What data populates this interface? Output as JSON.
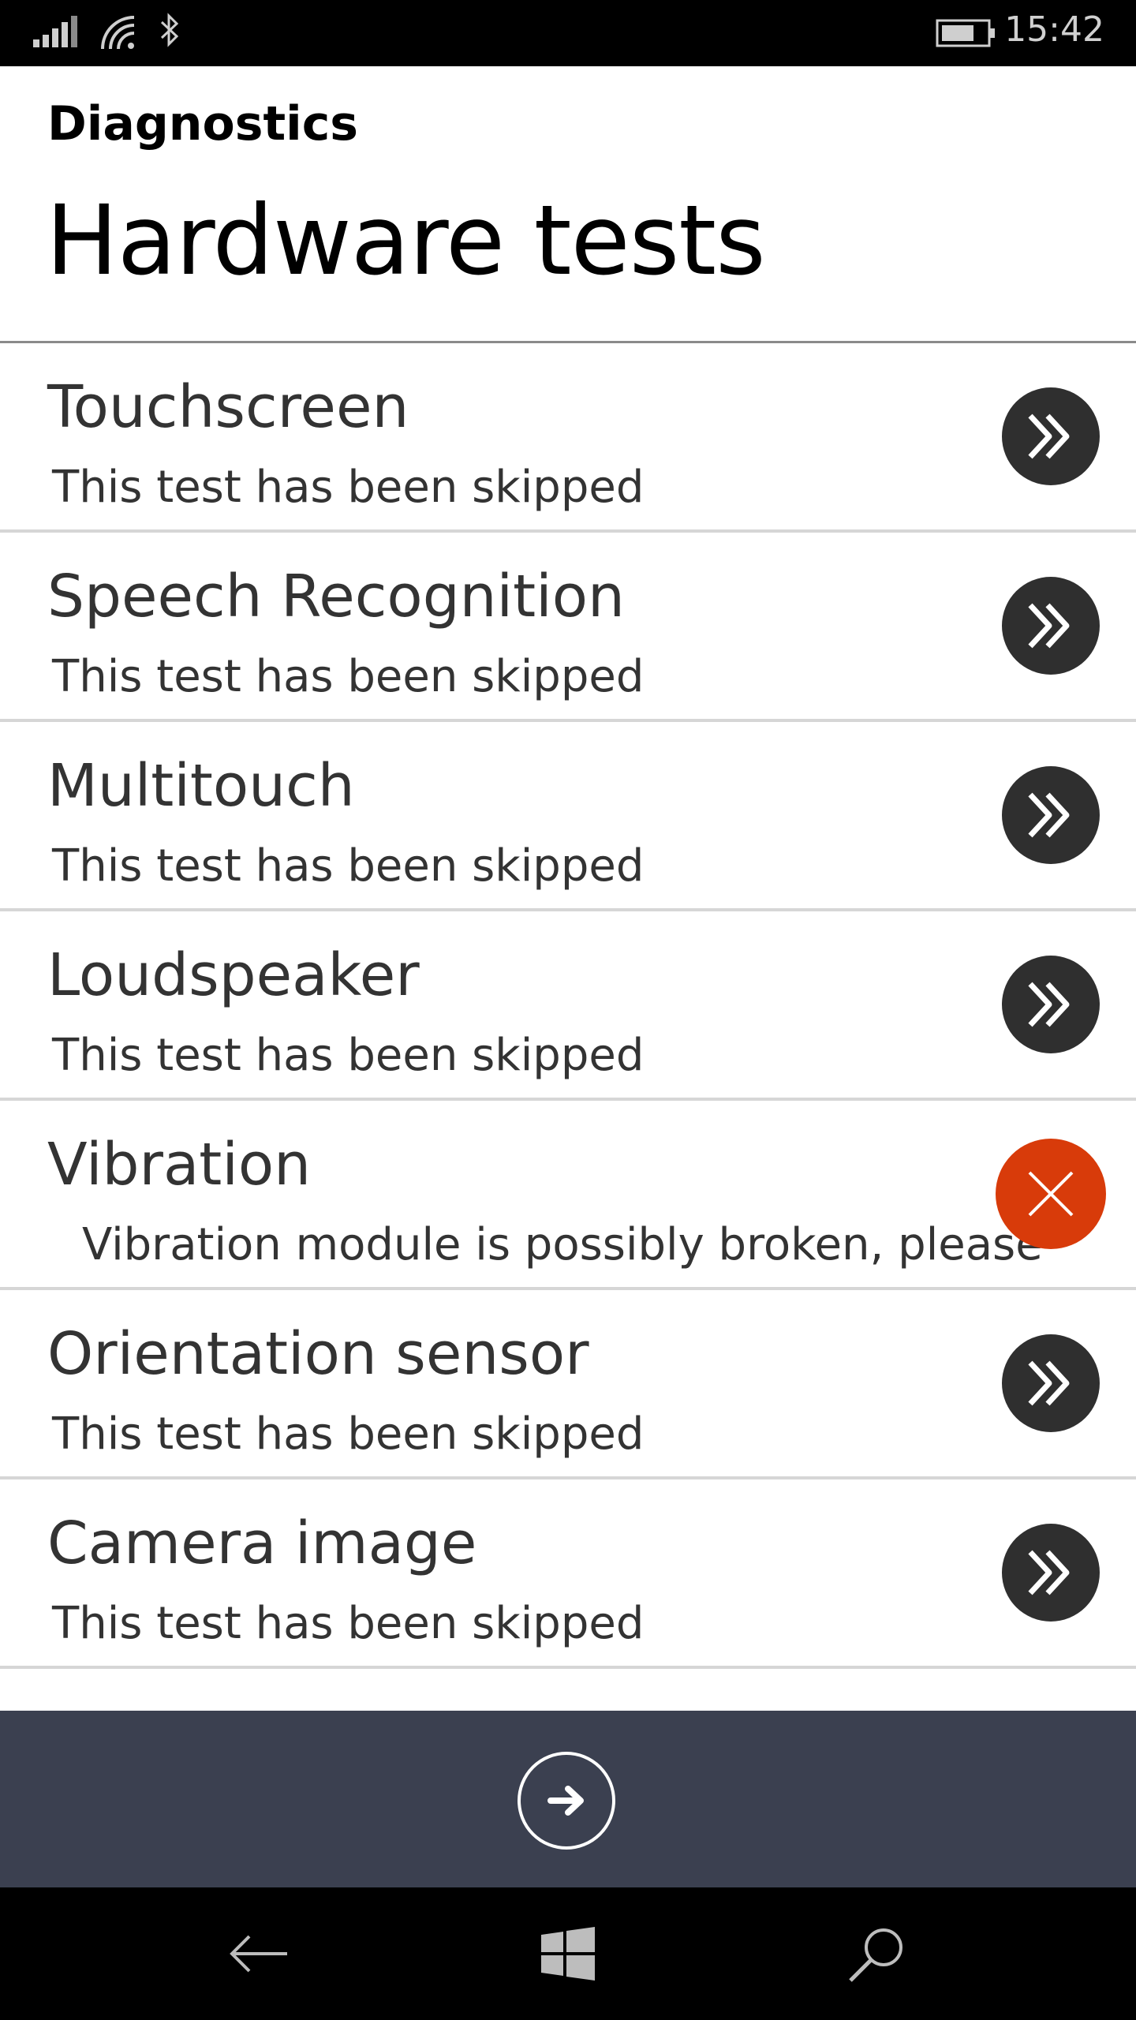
{
  "status_bar": {
    "time": "15:42",
    "icons": [
      "signal-icon",
      "wifi-icon",
      "bluetooth-icon",
      "battery-icon"
    ]
  },
  "header": {
    "app_title": "Diagnostics",
    "page_title": "Hardware tests"
  },
  "tests": [
    {
      "name": "Touchscreen",
      "status": "This test has been skipped",
      "result": "skipped",
      "icon": "skip-forward-icon"
    },
    {
      "name": "Speech Recognition",
      "status": "This test has been skipped",
      "result": "skipped",
      "icon": "skip-forward-icon"
    },
    {
      "name": "Multitouch",
      "status": "This test has been skipped",
      "result": "skipped",
      "icon": "skip-forward-icon"
    },
    {
      "name": "Loudspeaker",
      "status": "This test has been skipped",
      "result": "skipped",
      "icon": "skip-forward-icon"
    },
    {
      "name": "Vibration",
      "status": "Vibration module is possibly broken, please",
      "result": "failed",
      "icon": "close-icon"
    },
    {
      "name": "Orientation sensor",
      "status": "This test has been skipped",
      "result": "skipped",
      "icon": "skip-forward-icon"
    },
    {
      "name": "Camera image",
      "status": "This test has been skipped",
      "result": "skipped",
      "icon": "skip-forward-icon"
    }
  ],
  "app_bar": {
    "next_icon": "arrow-right-circle-icon"
  },
  "nav_bar": {
    "icons": [
      "back-arrow-icon",
      "windows-start-icon",
      "search-icon"
    ]
  },
  "colors": {
    "fail": "#d83b0a",
    "pass": "#1fa834",
    "skip": "#2f2f2f",
    "app_bar": "#3b4050"
  }
}
